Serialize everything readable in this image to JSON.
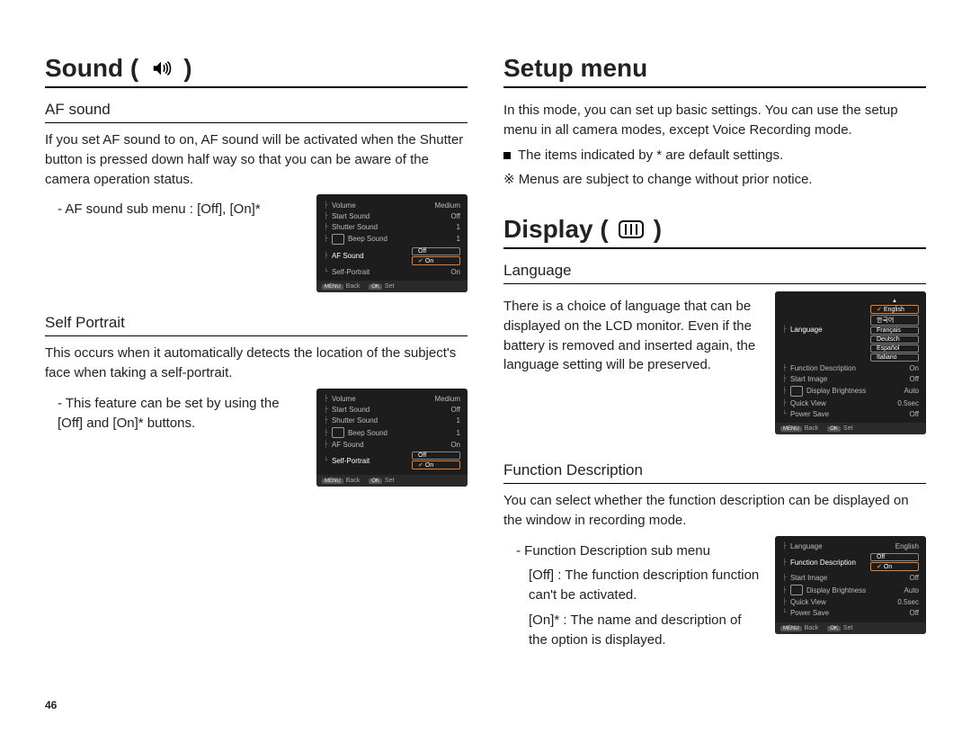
{
  "page_number": "46",
  "left": {
    "title": "Sound (",
    "title_end": ")",
    "sub1": {
      "heading": "AF sound",
      "p1": "If you set AF sound to on, AF sound will be activated when the Shutter button is pressed down half way so that you can be aware of the camera operation status.",
      "bullet": "- AF sound sub menu : [Off], [On]*",
      "menu": {
        "items": [
          {
            "l": "Volume",
            "r": "Medium"
          },
          {
            "l": "Start Sound",
            "r": "Off"
          },
          {
            "l": "Shutter Sound",
            "r": "1"
          },
          {
            "l": "Beep Sound",
            "r": "1"
          },
          {
            "l": "AF Sound",
            "r": "",
            "hl": true,
            "sub": [
              "Off",
              "On"
            ],
            "sel": 1
          },
          {
            "l": "Self-Portrait",
            "r": "On"
          }
        ],
        "back": "Back",
        "set": "Set",
        "menu_tag": "MENU",
        "ok_tag": "OK"
      }
    },
    "sub2": {
      "heading": "Self Portrait",
      "p1": "This occurs when it automatically detects the location of the subject's face when taking a self-portrait.",
      "bullet": "- This feature can be set by using the [Off] and [On]* buttons.",
      "menu": {
        "items": [
          {
            "l": "Volume",
            "r": "Medium"
          },
          {
            "l": "Start Sound",
            "r": "Off"
          },
          {
            "l": "Shutter Sound",
            "r": "1"
          },
          {
            "l": "Beep Sound",
            "r": "1"
          },
          {
            "l": "AF Sound",
            "r": "On"
          },
          {
            "l": "Self-Portrait",
            "r": "",
            "hl": true,
            "sub": [
              "Off",
              "On"
            ],
            "sel": 1
          }
        ],
        "back": "Back",
        "set": "Set",
        "menu_tag": "MENU",
        "ok_tag": "OK"
      }
    }
  },
  "right": {
    "setup": {
      "title": "Setup menu",
      "p1": "In this mode, you can set up basic settings. You can use the setup menu in all camera modes, except Voice Recording mode.",
      "b1": "The items indicated by * are default settings.",
      "b2": "※ Menus are subject to change without prior notice."
    },
    "display": {
      "title": "Display (",
      "title_end": ")",
      "lang": {
        "heading": "Language",
        "p1": "There is a choice of language that can be displayed on the LCD monitor. Even if the battery is removed and inserted again, the language setting will be preserved.",
        "menu": {
          "items": [
            {
              "l": "Language",
              "r": "",
              "hl": true,
              "langs": [
                "English",
                "한국어",
                "Français",
                "Deutsch",
                "Español",
                "Italiano"
              ],
              "sel": 0
            },
            {
              "l": "Function Description",
              "r": "On"
            },
            {
              "l": "Start Image",
              "r": "Off"
            },
            {
              "l": "Display Brightness",
              "r": "Auto"
            },
            {
              "l": "Quick View",
              "r": "0.5sec"
            },
            {
              "l": "Power Save",
              "r": "Off"
            }
          ],
          "back": "Back",
          "set": "Set",
          "menu_tag": "MENU",
          "ok_tag": "OK"
        }
      },
      "fd": {
        "heading": "Function Description",
        "p1": "You can select whether the function description can be displayed on the window in recording mode.",
        "bullet_top": "- Function Description sub menu",
        "line_off": "[Off] : The function description function can't be activated.",
        "line_on": "[On]* : The name and description of the option is displayed.",
        "menu": {
          "items": [
            {
              "l": "Language",
              "r": "English"
            },
            {
              "l": "Function Description",
              "r": "",
              "hl": true,
              "sub": [
                "Off",
                "On"
              ],
              "sel": 1
            },
            {
              "l": "Start Image",
              "r": "Off"
            },
            {
              "l": "Display Brightness",
              "r": "Auto"
            },
            {
              "l": "Quick View",
              "r": "0.5sec"
            },
            {
              "l": "Power Save",
              "r": "Off"
            }
          ],
          "back": "Back",
          "set": "Set",
          "menu_tag": "MENU",
          "ok_tag": "OK"
        }
      }
    }
  }
}
